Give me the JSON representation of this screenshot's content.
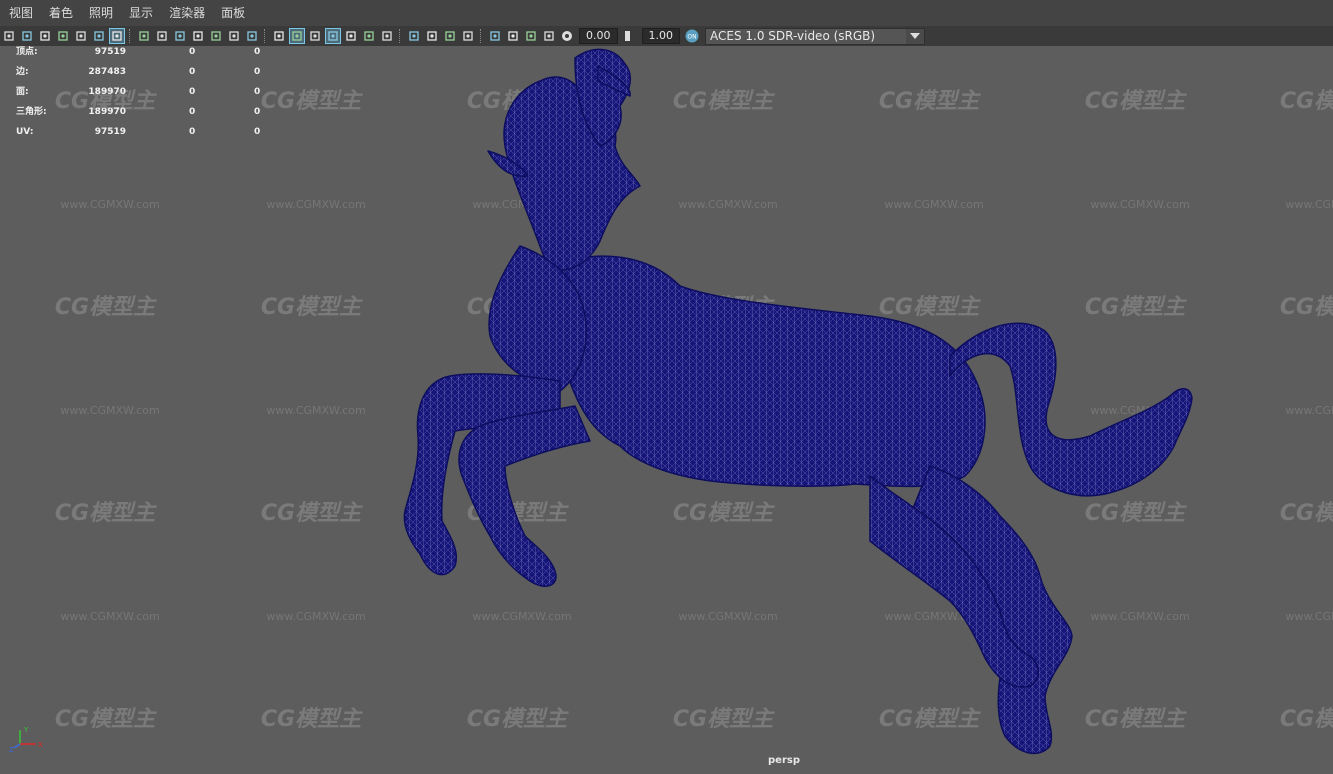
{
  "menu": [
    "视图",
    "着色",
    "照明",
    "显示",
    "渲染器",
    "面板"
  ],
  "toolbar": {
    "exposure_value": "0.00",
    "gamma_value": "1.00",
    "colorspace_value": "ACES 1.0 SDR-video (sRGB)",
    "icons": [
      "camera-select-icon",
      "camera-lock-icon",
      "camera-attributes-icon",
      "bookmark-icon",
      "image-plane-icon",
      "2d-pan-zoom-icon",
      "grease-pencil-icon",
      "grid-icon",
      "film-gate-icon",
      "resolution-gate-icon",
      "gate-mask-icon",
      "field-chart-icon",
      "safe-action-icon",
      "safe-title-icon",
      "wireframe-icon",
      "smooth-shade-icon",
      "default-material-icon",
      "wireframe-on-shaded-icon",
      "textured-icon",
      "use-lights-icon",
      "shadows-icon",
      "screen-space-ao-icon",
      "motion-blur-icon",
      "anti-aliasing-icon",
      "depth-of-field-icon",
      "isolate-select-icon",
      "xray-icon",
      "xray-joints-icon",
      "xray-active-icon"
    ]
  },
  "hud": {
    "rows": [
      {
        "label": "顶点:",
        "v1": "97519",
        "v2": "0",
        "v3": "0"
      },
      {
        "label": "边:",
        "v1": "287483",
        "v2": "0",
        "v3": "0"
      },
      {
        "label": "面:",
        "v1": "189970",
        "v2": "0",
        "v3": "0"
      },
      {
        "label": "三角形:",
        "v1": "189970",
        "v2": "0",
        "v3": "0"
      },
      {
        "label": "UV:",
        "v1": "97519",
        "v2": "0",
        "v3": "0"
      }
    ]
  },
  "watermark": {
    "logo": "CG模型主",
    "url": "www.CGMXW.com"
  },
  "viewport": {
    "camera": "persp"
  },
  "axis": {
    "y": "Y",
    "x": "X",
    "z": "Z"
  },
  "colors": {
    "mesh_fill": "#15157a",
    "mesh_line": "#8080c8",
    "viewport_bg": "#5d5d5d",
    "active_icon": "#7ac7e8"
  }
}
